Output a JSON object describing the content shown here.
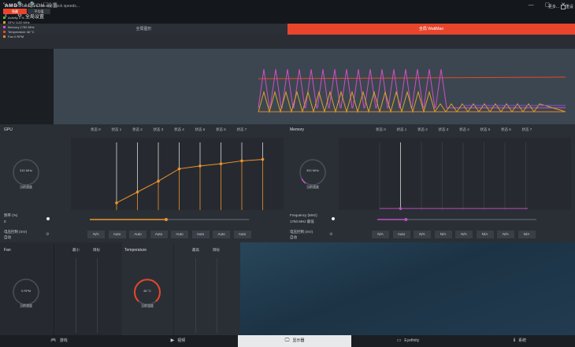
{
  "titlebar": {
    "brand": "AMD",
    "product": "RADEON",
    "settings": "设置",
    "window_controls": "— ▢ ✕",
    "back_glyph": "‹",
    "gear_glyph": "⚙",
    "page_title": "全局设置"
  },
  "tabs": [
    {
      "label": "全局图形"
    },
    {
      "label": "全局 WattMan"
    }
  ],
  "subheader": {
    "description": "View and configure fan and clock speeds...",
    "more": "更多...",
    "reset": "重设"
  },
  "monitor": {
    "toggle_label": "隐藏",
    "sampling_label": "平均值",
    "tools": [
      "‹",
      "🔍",
      "🔍",
      "⬚"
    ],
    "legend": [
      {
        "label": "Activity 0 %",
        "color": "#3fbf3f"
      },
      {
        "label": "GPU 1120 MHz",
        "color": "#d9a32a"
      },
      {
        "label": "Memory 1750 MHz",
        "color": "#d04fc4"
      },
      {
        "label": "Temperature 48 °C",
        "color": "#e04a2c"
      },
      {
        "label": "Fan 0 RPM",
        "color": "#e2842a"
      }
    ]
  },
  "gpu": {
    "title": "GPU",
    "gauge_value": "315 MHz",
    "gauge_caption": "当前速度",
    "states": [
      "状态 0",
      "状态 1",
      "状态 2",
      "状态 3",
      "状态 4",
      "状态 5",
      "状态 6",
      "状态 7"
    ],
    "freq_label": "频率 (%)",
    "freq_value": "0",
    "voltage_label": "电压控制 (mV)",
    "voltage_value": "自动",
    "voltage_buttons": [
      "N/A",
      "Auto",
      "Auto",
      "Auto",
      "Auto",
      "Auto",
      "Auto",
      "Auto"
    ],
    "curve": [
      0.1,
      0.25,
      0.4,
      0.57,
      0.61,
      0.64,
      0.68,
      0.7
    ],
    "slider_fraction": 0.48
  },
  "memory": {
    "title": "Memory",
    "gauge_value": "300 MHz",
    "gauge_caption": "当前速度",
    "states": [
      "状态 0",
      "状态 1",
      "状态 2",
      "状态 3",
      "状态 4",
      "状态 5",
      "状态 6",
      "状态 7"
    ],
    "freq_label": "Frequency (MHz)",
    "freq_value": "1750 MHz 最低",
    "voltage_label": "电压控制 (mV)",
    "voltage_value": "自动",
    "voltage_buttons": [
      "N/A",
      "Auto",
      "N/A",
      "N/A",
      "N/A",
      "N/A",
      "N/A",
      "N/A"
    ],
    "slider_fraction": 0.18
  },
  "fan": {
    "title": "Fan",
    "col_min": "最小",
    "col_target": "目标",
    "gauge_value": "0 RPM",
    "gauge_caption": "当前速度"
  },
  "temperature": {
    "title": "Temperature",
    "col_max": "最高",
    "col_target": "目标",
    "gauge_value": "48 °C",
    "gauge_caption": "当前温度"
  },
  "bottom_nav": [
    {
      "label": "游戏",
      "icon": "🎮"
    },
    {
      "label": "视频",
      "icon": "▶"
    },
    {
      "label": "显示器",
      "icon": "🖵"
    },
    {
      "label": "Eyefinity",
      "icon": "▭"
    },
    {
      "label": "系统",
      "icon": "ℹ"
    }
  ],
  "colors": {
    "accent": "#e8452c",
    "gpu_curve": "#f0932a",
    "memory": "#c04fbf"
  }
}
